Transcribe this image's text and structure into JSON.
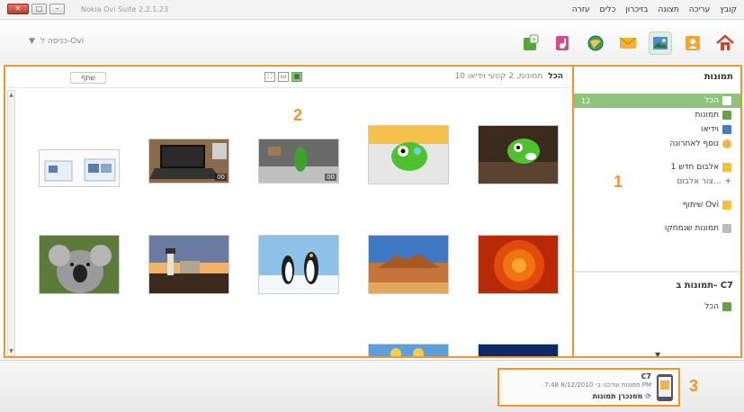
{
  "window": {
    "app_title": "Nokia Ovi Suite 2.2.1.23",
    "buttons": [
      "close",
      "maximize",
      "minimize"
    ]
  },
  "menu": [
    "קובץ",
    "עריכה",
    "תצוגה",
    "בזיכרון",
    "כלים",
    "עזרה"
  ],
  "toolbar": {
    "ovi_login": "כניסה ל-Ovi",
    "icons": [
      "home-icon",
      "contacts-icon",
      "photos-icon",
      "messages-icon",
      "maps-icon",
      "music-icon",
      "apps-icon"
    ],
    "active_icon": "photos-icon"
  },
  "gallery": {
    "share_label": "שתף",
    "all_label": "הכל",
    "summary": "10 תמונות, 2 קטעי וידיאו",
    "video_badge": "00",
    "callout": "2"
  },
  "sidebar": {
    "title": "תמונות",
    "items": [
      {
        "label": "הכל",
        "count": "12",
        "selected": true
      },
      {
        "label": "תמונות"
      },
      {
        "label": "וידיאו"
      },
      {
        "label": "נוסף לאחרונה"
      },
      {
        "label": "אלבום חדש 1"
      },
      {
        "label": "צור אלבום..."
      },
      {
        "label": "שיתוף Ovi"
      },
      {
        "label": "תמונות שנמחקו"
      }
    ],
    "callout": "1",
    "device_title": "תמונות ב- C7",
    "device_all": "הכל"
  },
  "footer": {
    "device_name": "C7",
    "updated": "תמונות עודכנו ב- 8/12/2010 7:48 PM",
    "sync_label": "מסנכרן תמונות",
    "callout": "3"
  },
  "colors": {
    "accent": "#f0952b",
    "selection": "#8dc37a"
  }
}
